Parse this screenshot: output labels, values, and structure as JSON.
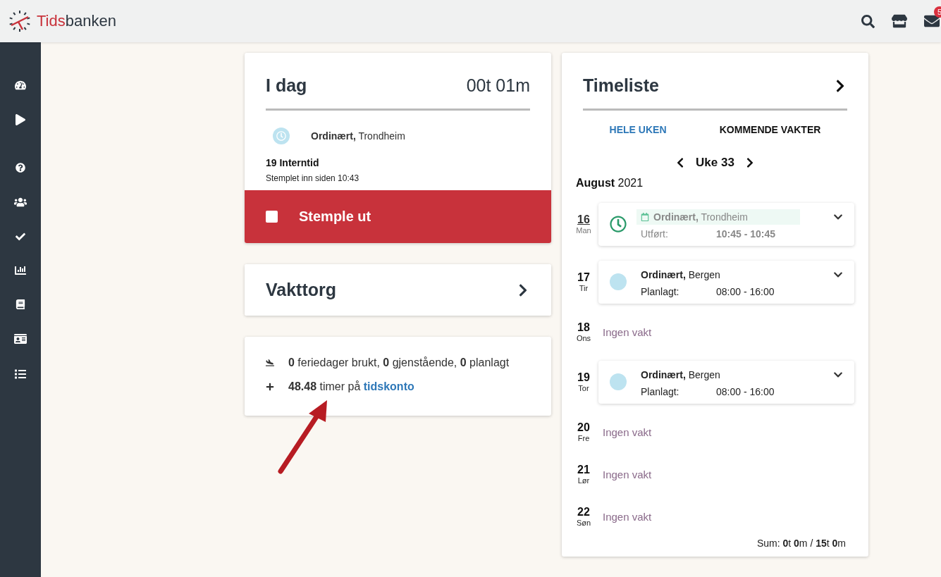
{
  "header": {
    "logo": {
      "part_1": "Tids",
      "part_2": "banken"
    },
    "mail_badge": "5"
  },
  "today": {
    "title": "I dag",
    "duration": "00t 01m",
    "shift_title": "Ordinært,",
    "shift_location": "Trondheim",
    "task": "19 Interntid",
    "since": "Stemplet inn siden 10:43",
    "button": "Stemple ut"
  },
  "vakttorg": {
    "title": "Vakttorg"
  },
  "stats": {
    "vacation": "**0** feriedager brukt, **0** gjenstående, **0** planlagt",
    "hours": "**48.48** timer på ",
    "hours_link": "tidskonto"
  },
  "timeliste": {
    "title": "Timeliste",
    "tabs": [
      {
        "label": "HELE UKEN",
        "selected": true
      },
      {
        "label": "KOMMENDE VAKTER",
        "selected": false
      }
    ],
    "week": "Uke 33",
    "month": "August",
    "year": "2021",
    "days": [
      {
        "date": "16",
        "weekday": "Man",
        "today": true,
        "kind": "completed",
        "title": "Ordinært,",
        "location": "Trondheim",
        "label": "Utført:",
        "time": "10:45 - 10:45"
      },
      {
        "date": "17",
        "weekday": "Tir",
        "today": false,
        "kind": "planned",
        "title": "Ordinært,",
        "location": "Bergen",
        "label": "Planlagt:",
        "time": "08:00 - 16:00"
      },
      {
        "date": "18",
        "weekday": "Ons",
        "today": false,
        "kind": "none",
        "text": "Ingen vakt"
      },
      {
        "date": "19",
        "weekday": "Tor",
        "today": false,
        "kind": "planned",
        "title": "Ordinært,",
        "location": "Bergen",
        "label": "Planlagt:",
        "time": "08:00 - 16:00"
      },
      {
        "date": "20",
        "weekday": "Fre",
        "today": false,
        "kind": "none",
        "text": "Ingen vakt"
      },
      {
        "date": "21",
        "weekday": "Lør",
        "today": false,
        "kind": "none",
        "text": "Ingen vakt"
      },
      {
        "date": "22",
        "weekday": "Søn",
        "today": false,
        "kind": "none",
        "text": "Ingen vakt"
      }
    ],
    "sum": "Sum: **0**t **0**m / **15**t **0**m"
  }
}
